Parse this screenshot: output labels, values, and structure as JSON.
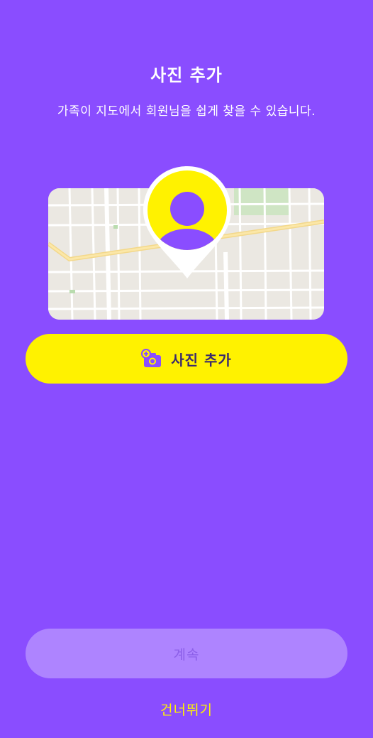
{
  "header": {
    "title": "사진 추가",
    "subtitle": "가족이 지도에서 회원님을 쉽게 찾을 수 있습니다."
  },
  "illustration": {
    "map_icon": "map-illustration",
    "pin_icon": "avatar-pin-icon"
  },
  "actions": {
    "add_photo_label": "사진 추가",
    "add_photo_icon": "camera-plus-icon",
    "continue_label": "계속",
    "continue_enabled": false,
    "skip_label": "건너뛰기"
  },
  "colors": {
    "background": "#8a4dff",
    "accent_yellow": "#fff200",
    "disabled_button": "#ae84ff"
  }
}
